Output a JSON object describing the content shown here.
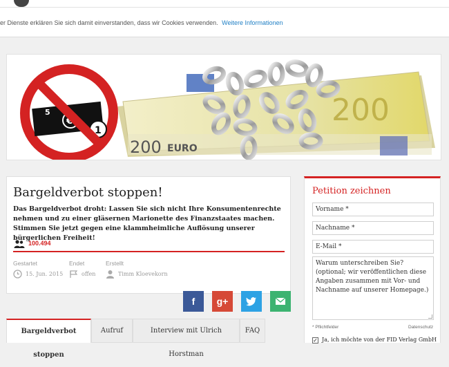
{
  "cookie": {
    "message": "er Dienste erklären Sie sich damit einverstanden, dass wir Cookies verwenden.",
    "link_label": "Weitere Informationen"
  },
  "hero": {
    "sign_number": "5",
    "banknote_value": "200",
    "banknote_text": "EURO",
    "coin_value": "1"
  },
  "petition_main": {
    "title": "Bargeldverbot stoppen!",
    "lead": "Das Bargeldverbot droht: Lassen Sie sich nicht Ihre Konsumentenrechte nehmen und zu einer gläsernen Marionette des Finanzstaates machen. Stimmen Sie jetzt gegen eine klammheimliche Auflösung unserer bürgerlichen Freiheit!",
    "supporter_count": "100.494",
    "meta": {
      "started_label": "Gestartet",
      "started_value": "15. Jun. 2015",
      "ends_label": "Endet",
      "ends_value": "offen",
      "created_label": "Erstellt",
      "created_value": "Timm Kloevekorn"
    }
  },
  "social": {
    "facebook": "f",
    "googleplus": "g+",
    "twitter": "t",
    "mail": "✉"
  },
  "tabs": [
    {
      "label": "Bargeldverbot stoppen",
      "active": true
    },
    {
      "label": "Aufruf",
      "active": false
    },
    {
      "label": "Interview mit Ulrich Horstman",
      "active": false
    },
    {
      "label": "FAQ",
      "active": false
    }
  ],
  "form": {
    "title": "Petition zeichnen",
    "first_name_placeholder": "Vorname *",
    "last_name_placeholder": "Nachname *",
    "email_placeholder": "E-Mail *",
    "reason_placeholder": "Warum unterschreiben Sie? (optional; wir veröffentlichen diese Angaben zusammen mit Vor- und Nachname auf unserer Homepage.)",
    "required_note": "* Pflichtfelder",
    "privacy_link": "Datenschutz",
    "consent_label": "Ja, ich möchte von der FID Verlag GmbH",
    "consent_checked": true
  },
  "colors": {
    "accent": "#d42222",
    "link": "#1f7fc4"
  }
}
